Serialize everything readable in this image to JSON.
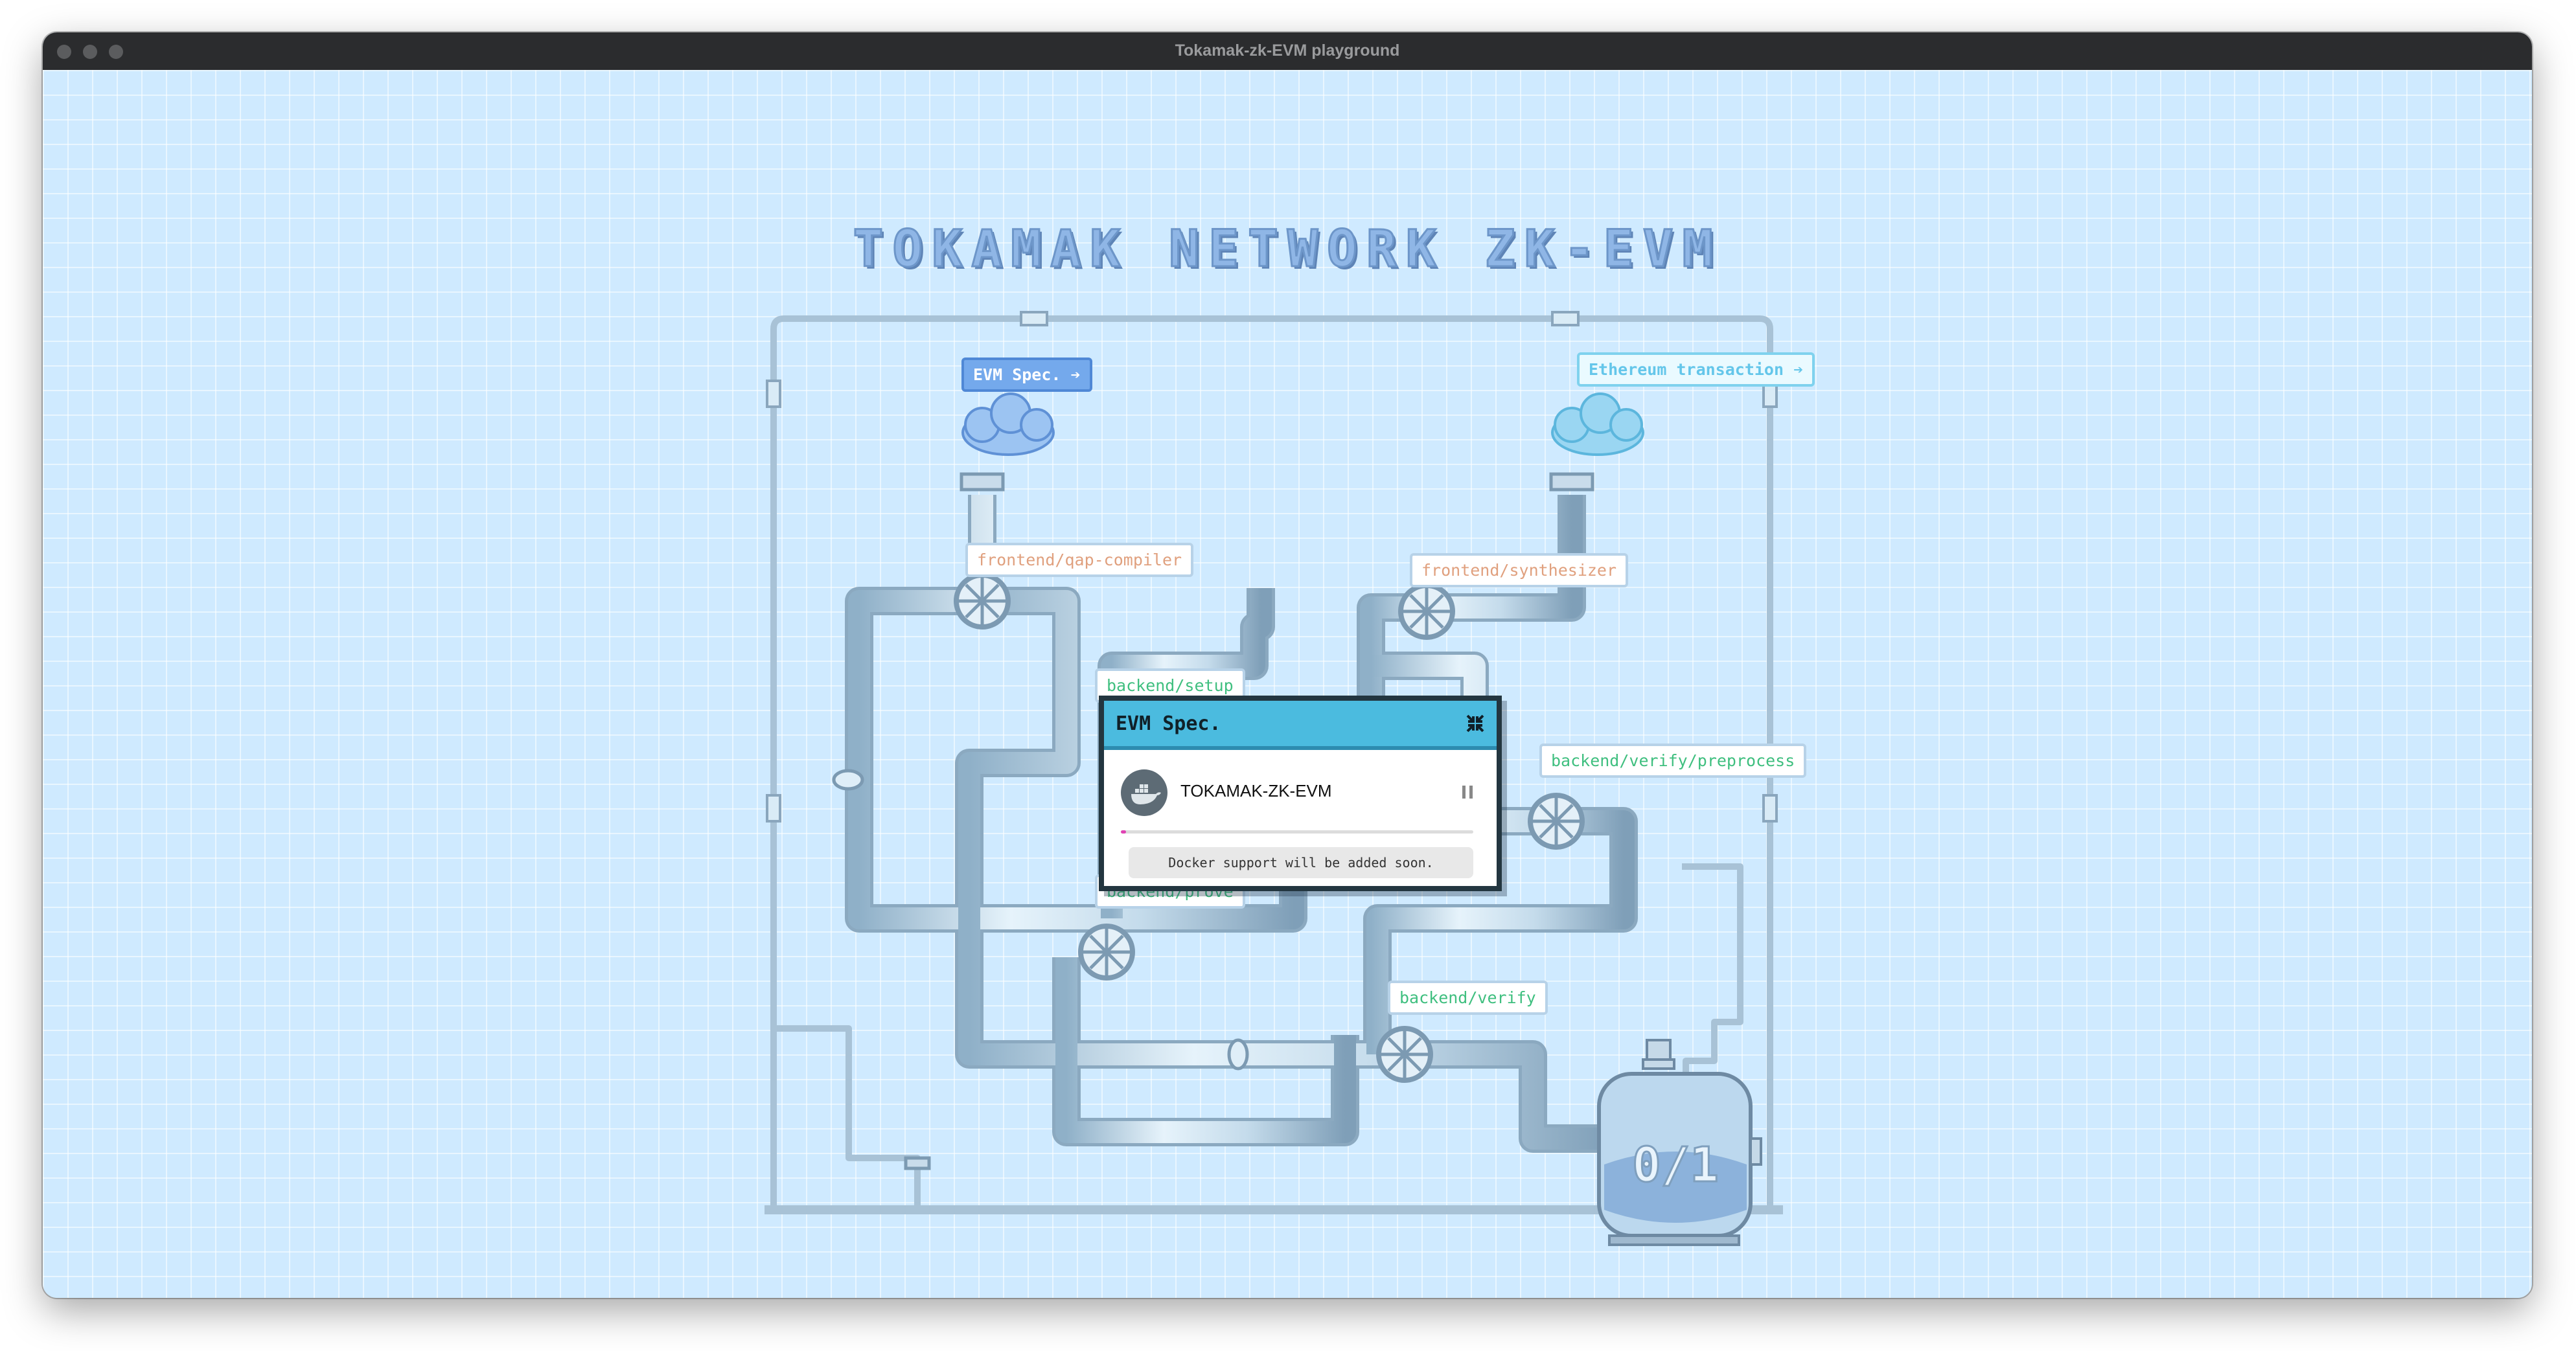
{
  "window": {
    "title": "Tokamak-zk-EVM playground"
  },
  "page": {
    "title": "TOKAMAK NETWORK ZK-EVM"
  },
  "links": {
    "evm_spec": "EVM Spec. ➔",
    "ethereum_transaction": "Ethereum transaction ➔"
  },
  "stages": {
    "qap_compiler": "frontend/qap-compiler",
    "synthesizer": "frontend/synthesizer",
    "setup": "backend/setup",
    "preprocess": "backend/verify/preprocess",
    "prove": "backend/prove",
    "verify": "backend/verify"
  },
  "tank": {
    "label": "0/1"
  },
  "modal": {
    "title": "EVM Spec.",
    "player_name": "TOKAMAK-ZK-EVM",
    "progress": 0.01,
    "note": "Docker support will be added soon."
  },
  "icons": {
    "close": "fullscreen-exit-icon",
    "pause": "pause-icon",
    "docker": "docker-icon",
    "cloud": "cloud-icon",
    "valve": "valve-wheel-icon"
  },
  "colors": {
    "background": "#cfeaff",
    "pipe": "#a9c6dd",
    "modal_header": "#4bbbdf",
    "progress": "#e043b4"
  }
}
